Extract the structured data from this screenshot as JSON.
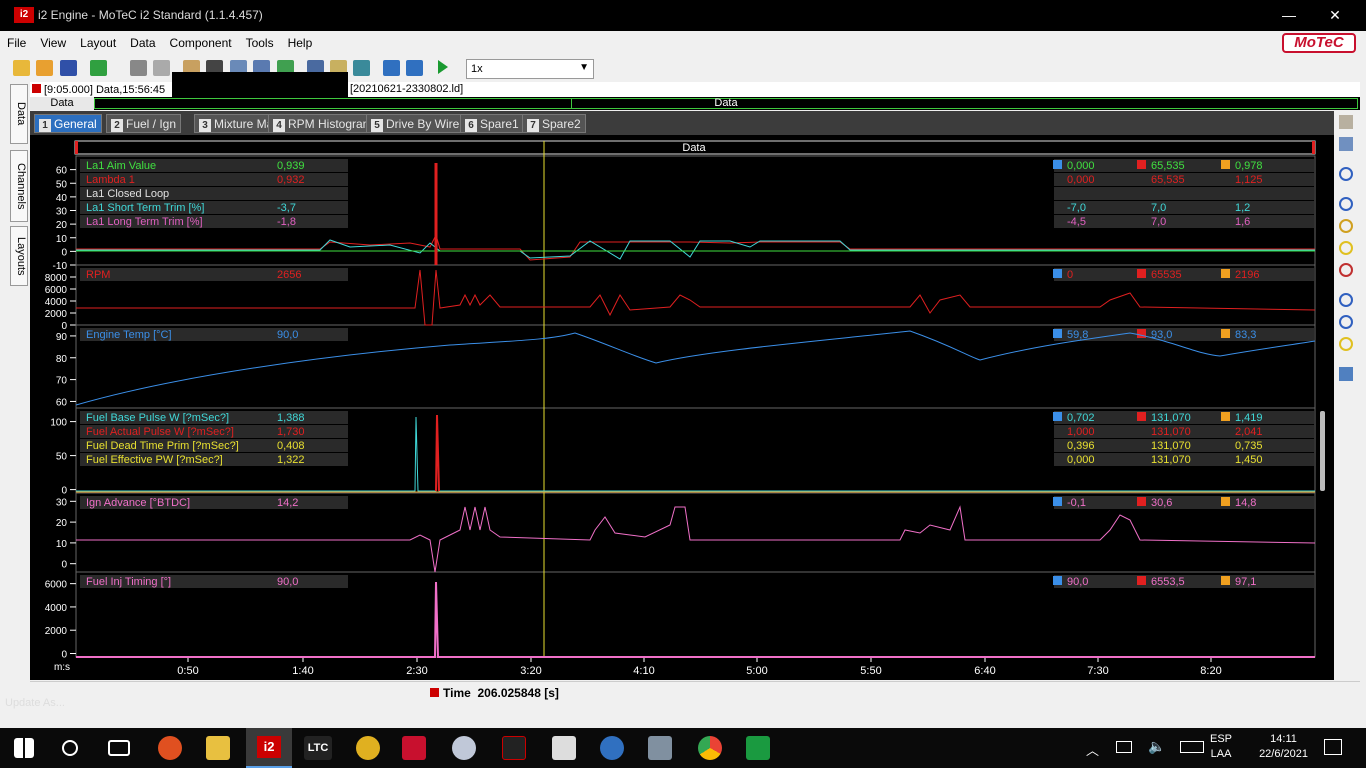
{
  "window": {
    "title": "i2 Engine - MoTeC i2 Standard (1.1.4.457)",
    "minimize": "—",
    "maximize": "■",
    "close": "✕"
  },
  "menu": [
    "File",
    "View",
    "Layout",
    "Data",
    "Component",
    "Tools",
    "Help"
  ],
  "brand": "MoTeC",
  "toolbar": {
    "zoom": "1x"
  },
  "file_bar": {
    "left": "[9:05.000] Data,15:56:45",
    "right": "[20210621-2330802.ld]"
  },
  "range_bar": {
    "left": "Data",
    "center": "Data"
  },
  "side_tabs": [
    "Data",
    "Channels",
    "Layouts"
  ],
  "tabs": [
    {
      "num": "1",
      "label": "General",
      "active": true
    },
    {
      "num": "2",
      "label": "Fuel / Ign",
      "active": false
    },
    {
      "num": "3",
      "label": "Mixture Map",
      "active": false
    },
    {
      "num": "4",
      "label": "RPM Histogram",
      "active": false
    },
    {
      "num": "5",
      "label": "Drive By Wire",
      "active": false
    },
    {
      "num": "6",
      "label": "Spare1",
      "active": false
    },
    {
      "num": "7",
      "label": "Spare2",
      "active": false
    }
  ],
  "plot": {
    "header": "Data",
    "x_unit": "m:s",
    "x_ticks": [
      "0:50",
      "1:40",
      "2:30",
      "3:20",
      "4:10",
      "5:00",
      "5:50",
      "6:40",
      "7:30",
      "8:20"
    ],
    "panes": [
      {
        "y_ticks": [
          "60",
          "50",
          "40",
          "30",
          "20",
          "10",
          "0",
          "-10"
        ],
        "channels": [
          {
            "name": "La1 Aim Value",
            "value": "0,939",
            "min": "0,000",
            "max": "65,535",
            "avg": "0,978",
            "color": "#40e040"
          },
          {
            "name": "Lambda 1",
            "value": "0,932",
            "min": "0,000",
            "max": "65,535",
            "avg": "1,125",
            "color": "#e02020"
          },
          {
            "name": "La1 Closed Loop",
            "value": "",
            "min": "",
            "max": "",
            "avg": "",
            "color": "#e0e0e0"
          },
          {
            "name": "La1 Short Term Trim [%]",
            "value": "-3,7",
            "min": "-7,0",
            "max": "7,0",
            "avg": "1,2",
            "color": "#40d8d8"
          },
          {
            "name": "La1 Long Term Trim [%]",
            "value": "-1,8",
            "min": "-4,5",
            "max": "7,0",
            "avg": "1,6",
            "color": "#e060c0"
          }
        ]
      },
      {
        "y_ticks": [
          "8000",
          "6000",
          "4000",
          "2000",
          "0"
        ],
        "channels": [
          {
            "name": "RPM",
            "value": "2656",
            "min": "0",
            "max": "65535",
            "avg": "2196",
            "color": "#e02020"
          }
        ]
      },
      {
        "y_ticks": [
          "90",
          "80",
          "70",
          "60"
        ],
        "channels": [
          {
            "name": "Engine Temp [°C]",
            "value": "90,0",
            "min": "59,8",
            "max": "93,0",
            "avg": "83,3",
            "color": "#3b8fe8"
          }
        ]
      },
      {
        "y_ticks": [
          "100",
          "50",
          "0"
        ],
        "channels": [
          {
            "name": "Fuel Base Pulse W [?mSec?]",
            "value": "1,388",
            "min": "0,702",
            "max": "131,070",
            "avg": "1,419",
            "color": "#40d8d8"
          },
          {
            "name": "Fuel Actual Pulse W [?mSec?]",
            "value": "1,730",
            "min": "1,000",
            "max": "131,070",
            "avg": "2,041",
            "color": "#e02020"
          },
          {
            "name": "Fuel Dead Time Prim [?mSec?]",
            "value": "0,408",
            "min": "0,396",
            "max": "131,070",
            "avg": "0,735",
            "color": "#e8e030"
          },
          {
            "name": "Fuel Effective PW [?mSec?]",
            "value": "1,322",
            "min": "0,000",
            "max": "131,070",
            "avg": "1,450",
            "color": "#e8e030"
          }
        ]
      },
      {
        "y_ticks": [
          "30",
          "20",
          "10",
          "0"
        ],
        "channels": [
          {
            "name": "Ign Advance [°BTDC]",
            "value": "14,2",
            "min": "-0,1",
            "max": "30,6",
            "avg": "14,8",
            "color": "#f070c8"
          }
        ]
      },
      {
        "y_ticks": [
          "6000",
          "4000",
          "2000",
          "0"
        ],
        "channels": [
          {
            "name": "Fuel Inj Timing [°]",
            "value": "90,0",
            "min": "90,0",
            "max": "6553,5",
            "avg": "97,1",
            "color": "#f070c8"
          }
        ]
      }
    ]
  },
  "status": {
    "time_label": "Time",
    "time_value": "206.025848 [s]"
  },
  "taskbar": {
    "lang": "ESP",
    "lang2": "LAA",
    "time": "14:11",
    "date": "22/6/2021",
    "ltc": "LTC",
    "update": "Update As..."
  }
}
